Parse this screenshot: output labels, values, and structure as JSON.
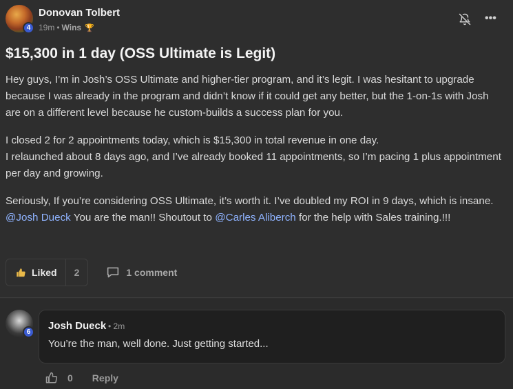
{
  "post": {
    "author": "Donovan Tolbert",
    "author_level": "4",
    "time": "19m",
    "separator": "•",
    "category": "Wins",
    "title": "$15,300 in 1 day (OSS Ultimate is Legit)",
    "paragraphs": {
      "p1": "Hey guys, I’m in Josh’s OSS Ultimate and higher-tier program, and it’s legit. I was hesitant to upgrade because I was already in the program and didn’t know if it could get any better, but the 1-on-1s with Josh are on a different level because he custom-builds a success plan for you.",
      "p2_line1": "I closed 2 for 2 appointments today, which is $15,300 in total revenue in one day.",
      "p2_line2": "I relaunched about 8 days ago, and I’ve already booked 11 appointments, so I’m pacing 1 plus appointment per day and growing.",
      "p3_line1": "Seriously, If you’re considering OSS Ultimate, it’s worth it. I’ve doubled my ROI in 9 days, which is insane.",
      "mention1": "@Josh Dueck",
      "p3_mid": " You are the man!! Shoutout to ",
      "mention2": "@Carles Aliberch",
      "p3_end": " for the help with Sales training.!!!"
    },
    "liked_label": "Liked",
    "like_count": "2",
    "comment_label": "1 comment",
    "more_label": "•••"
  },
  "comment": {
    "author": "Josh Dueck",
    "author_level": "6",
    "time": "• 2m",
    "text": "You’re the man, well done. Just getting started...",
    "like_count": "0",
    "reply_label": "Reply"
  },
  "icons": {
    "bell": "bell-off-icon",
    "more": "more-options-icon",
    "like": "thumbs-up-icon",
    "comment": "comment-icon",
    "trophy": "trophy-icon"
  },
  "colors": {
    "background": "#2e2e2e",
    "mention": "#8fb3ff",
    "level_badge": "#3a5bd1",
    "trophy": "#d7a13a"
  }
}
